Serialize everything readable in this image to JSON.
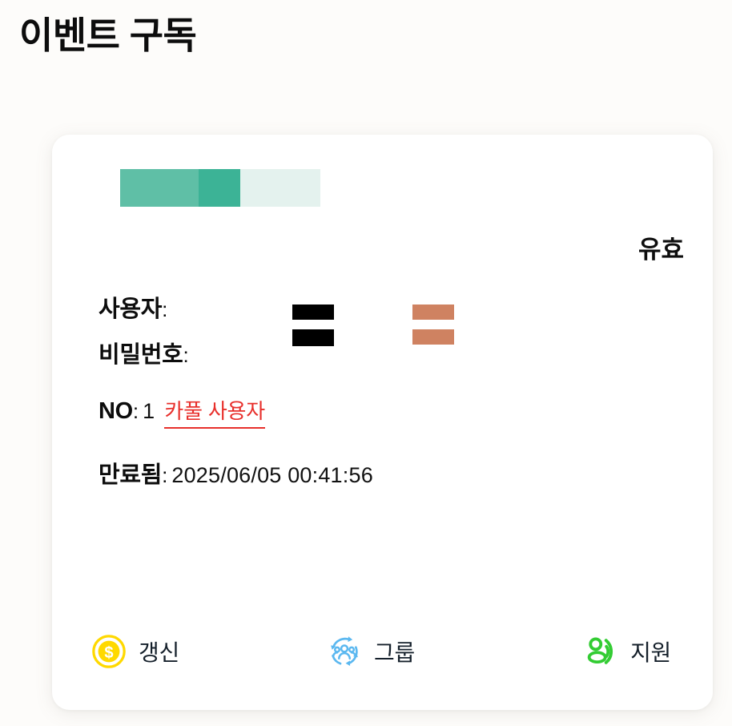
{
  "page": {
    "title": "이벤트 구독",
    "background_color": "#fdfcfa"
  },
  "card": {
    "background_color": "#ffffff",
    "usage_bar": {
      "name": "usage-bar",
      "segments": [
        {
          "label": "segment-1",
          "color": "#5fbfa6",
          "width_pct": 25
        },
        {
          "label": "segment-2",
          "color": "#5fbfa6",
          "width_pct": 14
        },
        {
          "label": "segment-3",
          "color": "#3cb396",
          "width_pct": 21
        },
        {
          "label": "segment-4",
          "color": "#e4f2ee",
          "width_pct": 40
        }
      ]
    },
    "status": {
      "label": "유효",
      "color": "#0d0d0d"
    },
    "fields": {
      "user": {
        "label": "사용자",
        "colon": ":",
        "value": ""
      },
      "password": {
        "label": "비밀번호",
        "colon": ":",
        "value": ""
      },
      "no": {
        "label": "NO",
        "colon": ":",
        "value": "1",
        "tag": "카풀 사용자",
        "tag_color": "#e8302c"
      },
      "expiry": {
        "label": "만료됨",
        "colon": ":",
        "value": "2025/06/05 00:41:56"
      }
    },
    "redactions": {
      "black_color": "#000000",
      "orange_color": "#cf8261"
    },
    "actions": [
      {
        "id": "renew",
        "label": "갱신",
        "icon": "coin-dollar-icon",
        "icon_color": "#ffd900"
      },
      {
        "id": "group",
        "label": "그룹",
        "icon": "group-refresh-icon",
        "icon_color": "#5bb8f0"
      },
      {
        "id": "support",
        "label": "지원",
        "icon": "support-person-icon",
        "icon_color": "#33cc33"
      }
    ]
  }
}
